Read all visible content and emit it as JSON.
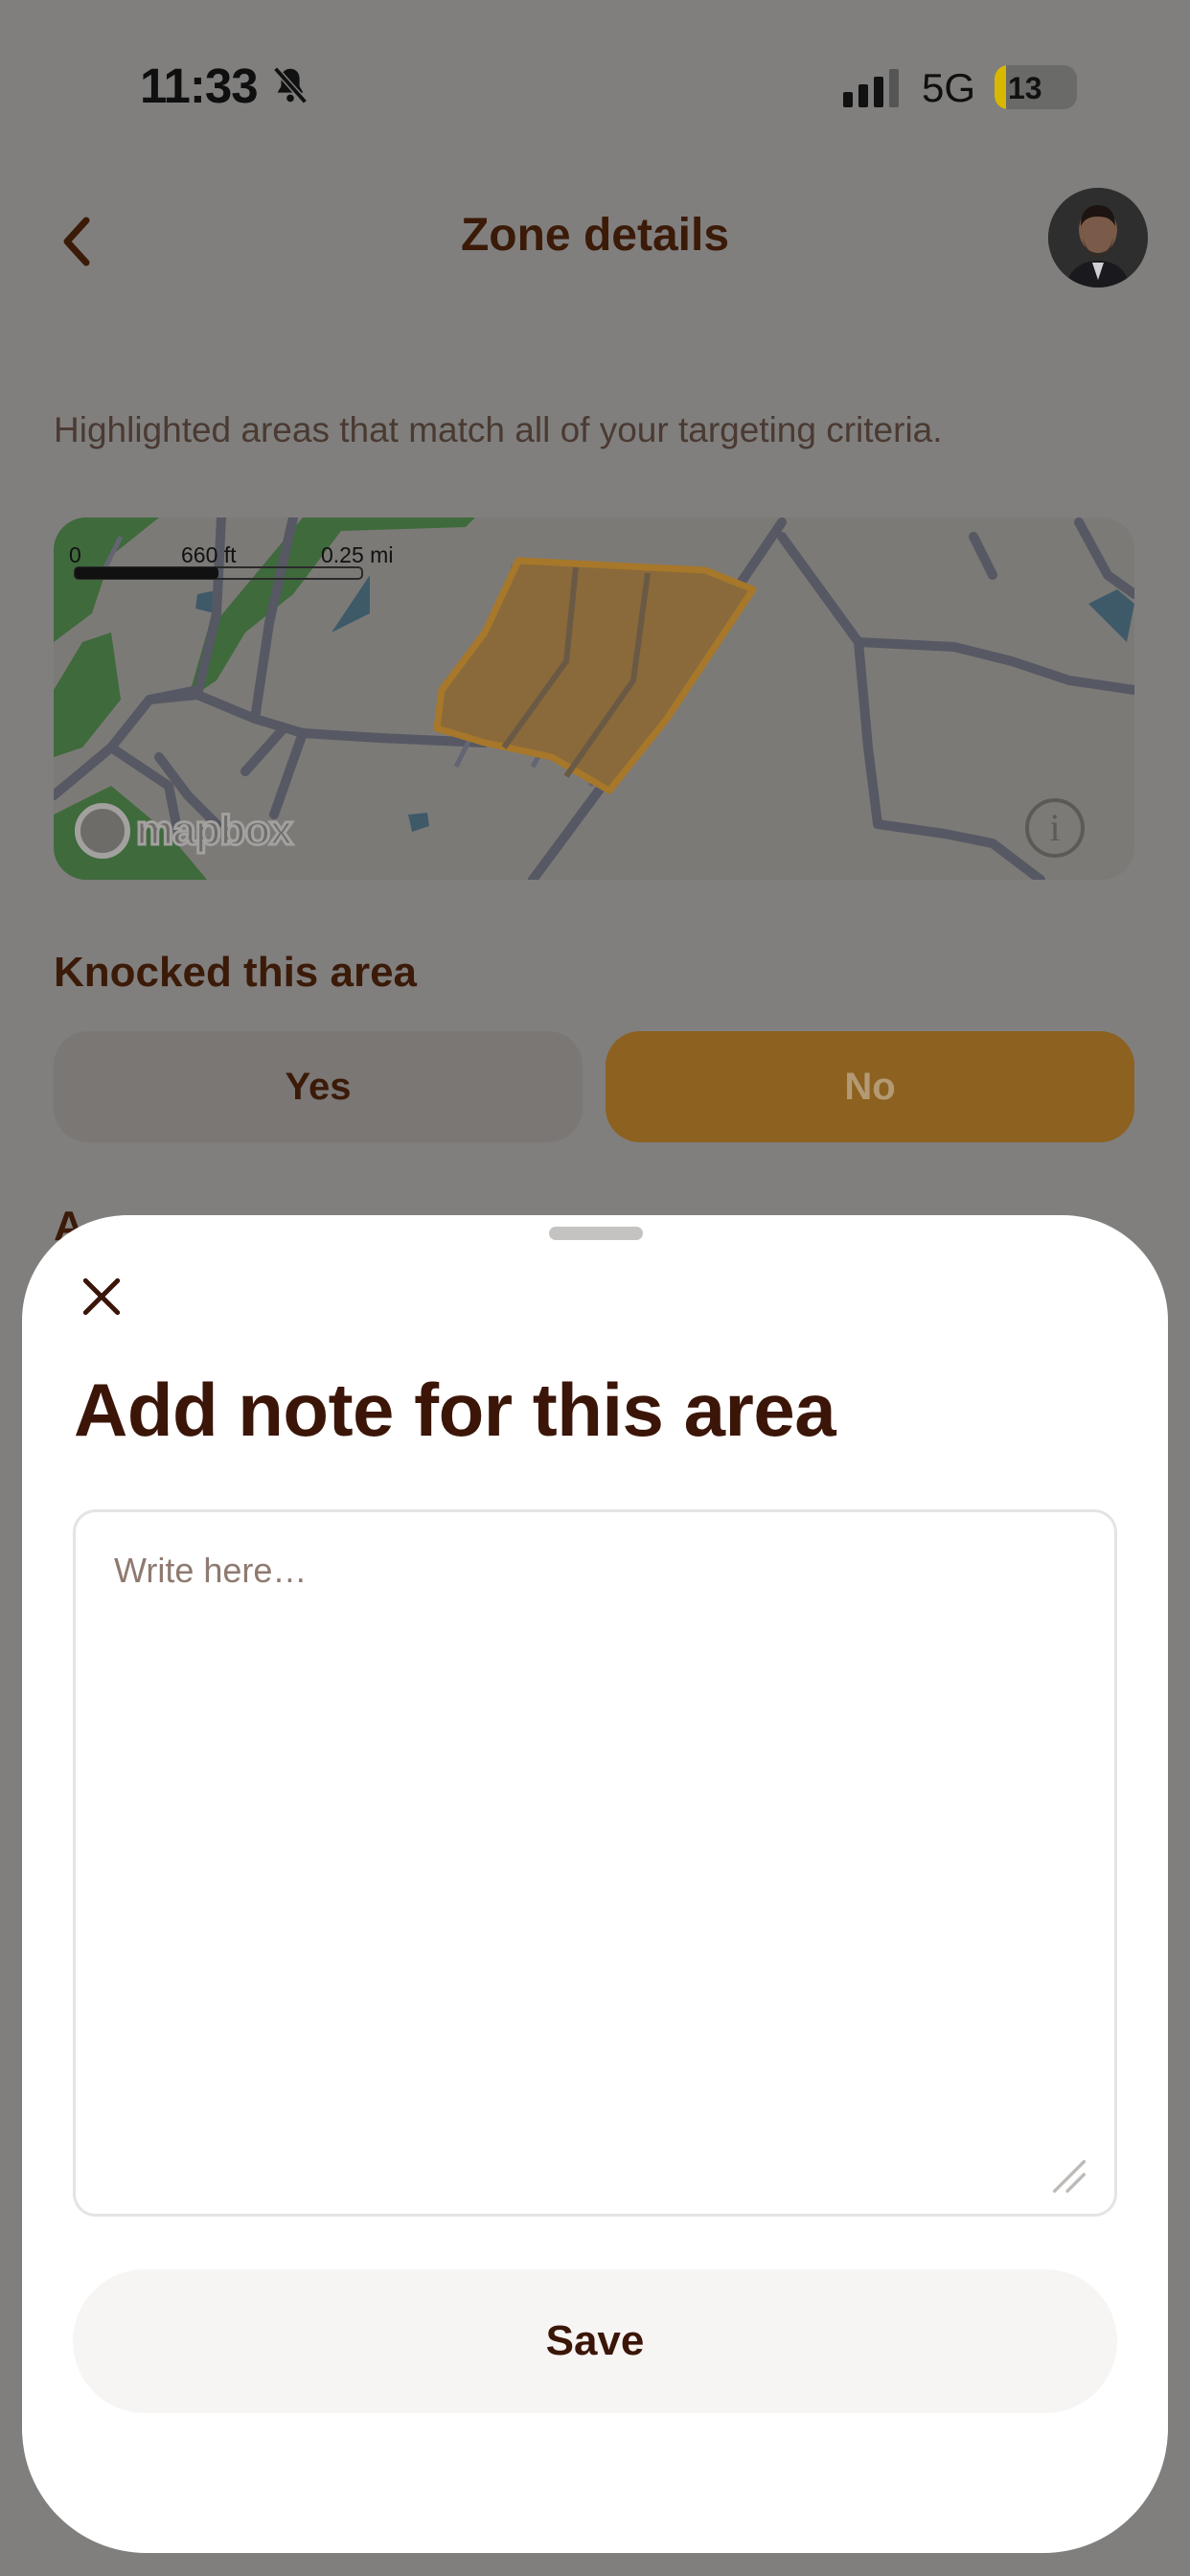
{
  "status_bar": {
    "time": "11:33",
    "network": "5G",
    "battery": "13"
  },
  "header": {
    "title": "Zone details"
  },
  "content": {
    "subtitle": "Highlighted areas that match all of your targeting criteria.",
    "map": {
      "scale_zero": "0",
      "scale_ft": "660 ft",
      "scale_mi": "0.25 mi",
      "attribution": "mapbox"
    },
    "knocked_label": "Knocked this area",
    "knocked_options": {
      "yes": "Yes",
      "no": "No"
    },
    "knocked_selected": "No"
  },
  "sheet": {
    "title": "Add note for this area",
    "placeholder": "Write here…",
    "value": "",
    "save_label": "Save"
  },
  "colors": {
    "accent": "#d99a2b",
    "text_primary": "#3b1608",
    "overlay": "#7d7c7b"
  }
}
